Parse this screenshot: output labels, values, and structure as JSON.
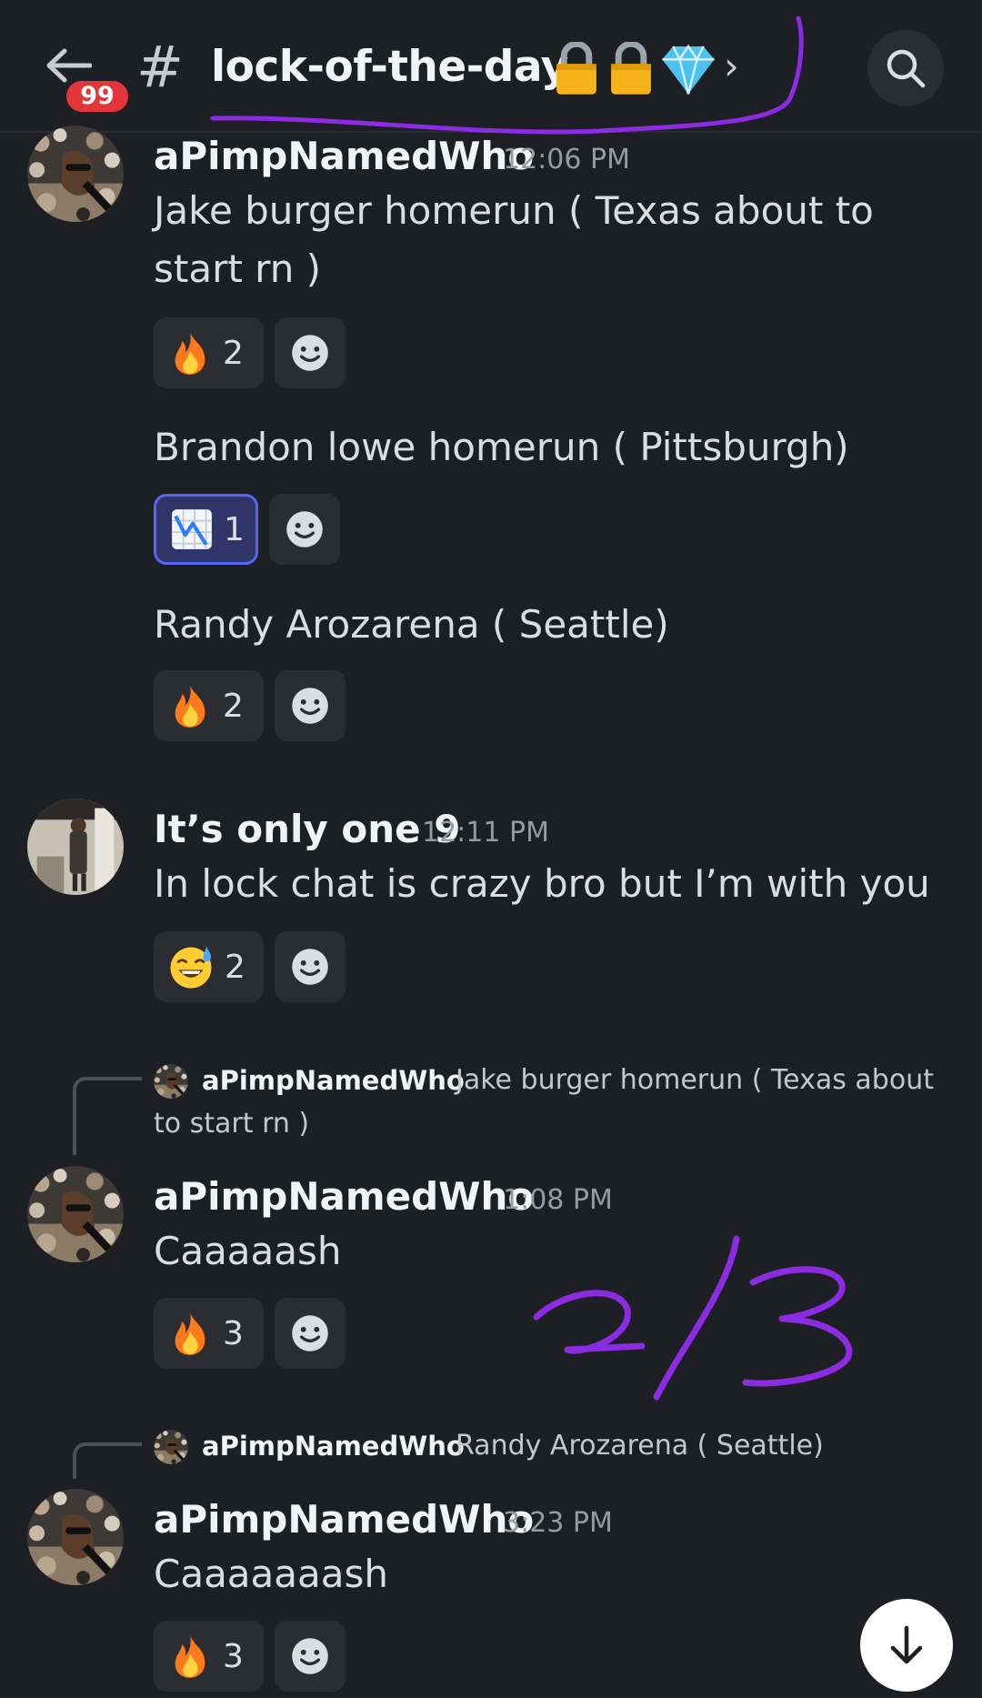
{
  "header": {
    "unread_badge": "99",
    "hash": "#",
    "channel_name": "lock-of-the-day",
    "chevron": "›",
    "icons": {
      "back": "arrow-left-icon",
      "search": "search-icon",
      "emoji": [
        "lock-emoji",
        "lock-emoji",
        "gem-emoji"
      ]
    }
  },
  "annotations": {
    "handwritten_score": "2/3",
    "color": "#8b2be2"
  },
  "messages": [
    {
      "username": "aPimpNamedWho",
      "time": "12:06 PM",
      "lines": [
        {
          "text": "Jake burger homerun ( Texas about to start rn )",
          "reaction": {
            "emoji": "fire",
            "count": "2"
          }
        },
        {
          "text": "Brandon lowe homerun ( Pittsburgh)",
          "reaction": {
            "emoji": "chart-decreasing",
            "count": "1"
          }
        },
        {
          "text": "Randy Arozarena ( Seattle)",
          "reaction": {
            "emoji": "fire",
            "count": "2"
          }
        }
      ]
    },
    {
      "username": "It’s only one 9",
      "time": "12:11 PM",
      "text": "In lock chat is crazy bro but I’m with you",
      "reaction": {
        "emoji": "grinning-sweat",
        "count": "2"
      }
    },
    {
      "reply_to": {
        "username": "aPimpNamedWho",
        "text": "Jake burger homerun ( Texas about to start rn )"
      },
      "username": "aPimpNamedWho",
      "time": "1:08 PM",
      "text": "Caaaaash",
      "reaction": {
        "emoji": "fire",
        "count": "3"
      }
    },
    {
      "reply_to": {
        "username": "aPimpNamedWho",
        "text": "Randy Arozarena ( Seattle)"
      },
      "username": "aPimpNamedWho",
      "time": "3:23 PM",
      "text": "Caaaaaaash",
      "reaction": {
        "emoji": "fire",
        "count": "3"
      }
    }
  ],
  "colors": {
    "background": "#1e1f24",
    "reaction_bg": "#2b2d33",
    "active_reaction_border": "#5865f2",
    "badge": "#e3353a"
  }
}
